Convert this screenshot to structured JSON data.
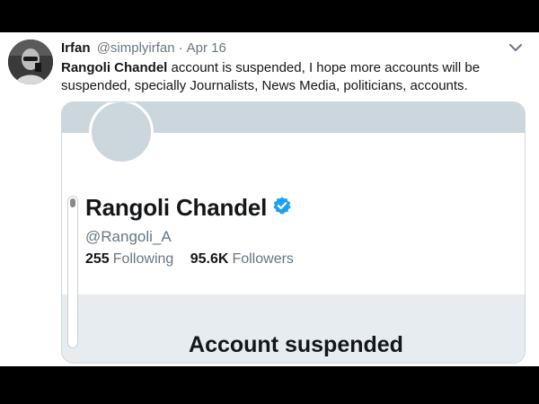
{
  "tweet": {
    "author_name": "Irfan",
    "author_handle": "@simplyirfan",
    "separator": "·",
    "date": "Apr 16",
    "text_bold": "Rangoli Chandel",
    "text_rest": " account is suspended, I hope more accounts will be suspended, specially Journalists, News Media, politicians, accounts.",
    "icons": {
      "avatar": "user-avatar-photo",
      "menu": "chevron-down-icon"
    }
  },
  "profile_card": {
    "display_name": "Rangoli Chandel",
    "username": "@Rangoli_A",
    "following_count": "255",
    "following_label": "Following",
    "followers_count": "95.6K",
    "followers_label": "Followers",
    "status_text": "Account suspended",
    "icons": {
      "verified": "verified-badge-icon",
      "profile_pic": "profile-picture-placeholder"
    }
  },
  "colors": {
    "page_background": "#000000",
    "tweet_background": "#ffffff",
    "primary_text": "#14171a",
    "secondary_text": "#657786",
    "verified_blue": "#1da1f2",
    "placeholder_gray": "#ccd6dd",
    "suspended_band": "#e6ecf0"
  }
}
